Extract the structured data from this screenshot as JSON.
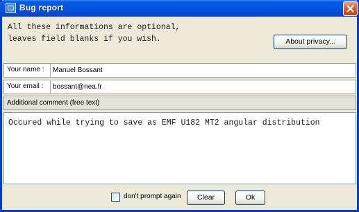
{
  "window": {
    "title": "Bug report",
    "app_icon": "app-icon",
    "close_icon": "close-icon",
    "title_color": "#0a5ce6",
    "close_color": "#d95a2c"
  },
  "notice": {
    "line1": "All these informations are optional,",
    "line2": "leaves field blanks if you wish."
  },
  "about_privacy_button": "About privacy...",
  "name_field": {
    "label": "Your name :",
    "value": "Manuel Bossant"
  },
  "email_field": {
    "label": "Your email :",
    "value": "bossant@nea.fr"
  },
  "comment": {
    "header": "Additional comment (free text)",
    "value": "Occured while trying to save as EMF U182 MT2 angular distribution"
  },
  "footer": {
    "dont_prompt_label": "don't prompt again",
    "dont_prompt_checked": false,
    "clear_button": "Clear",
    "ok_button": "Ok"
  }
}
